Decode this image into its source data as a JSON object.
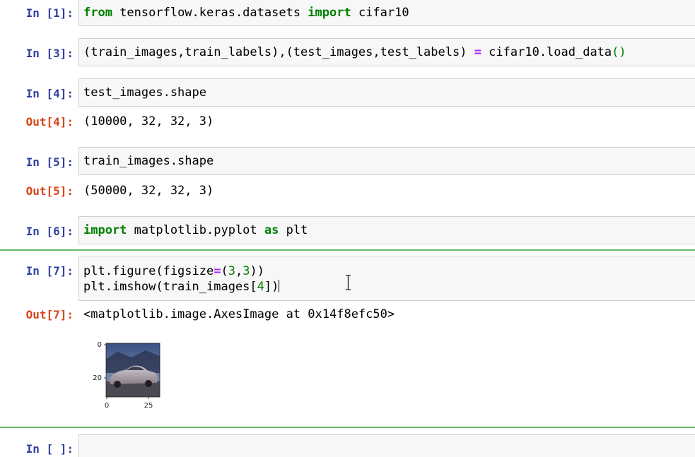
{
  "cells": [
    {
      "prompt": "In [1]:",
      "code": [
        "from tensorflow.keras.datasets import cifar10"
      ]
    },
    {
      "prompt": "In [3]:",
      "code": [
        "(train_images,train_labels),(test_images,test_labels) = cifar10.load_data()"
      ]
    },
    {
      "prompt": "In [4]:",
      "code": [
        "test_images.shape"
      ],
      "out_prompt": "Out[4]:",
      "output": "(10000, 32, 32, 3)"
    },
    {
      "prompt": "In [5]:",
      "code": [
        "train_images.shape"
      ],
      "out_prompt": "Out[5]:",
      "output": "(50000, 32, 32, 3)"
    },
    {
      "prompt": "In [6]:",
      "code": [
        "import matplotlib.pyplot as plt"
      ]
    },
    {
      "prompt": "In [7]:",
      "code": [
        "plt.figure(figsize=(3,3))",
        "plt.imshow(train_images[4])"
      ],
      "out_prompt": "Out[7]:",
      "output": "<matplotlib.image.AxesImage at 0x14f8efc50>"
    },
    {
      "prompt": "In [ ]:",
      "code": [
        ""
      ]
    }
  ],
  "plot": {
    "y_ticks": [
      "0",
      "20"
    ],
    "x_ticks": [
      "0",
      "25"
    ],
    "image_description_icon": "car-thumbnail"
  },
  "colors": {
    "in_prompt": "#303f9f",
    "out_prompt": "#d84315",
    "keyword": "#008000",
    "operator": "#aa22ff",
    "selected_bar": "#66bb6a"
  }
}
